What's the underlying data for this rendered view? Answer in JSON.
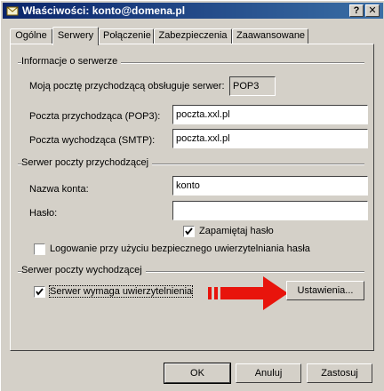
{
  "window": {
    "title": "Właściwości: konto@domena.pl",
    "help_btn": "?",
    "close_btn": "✕"
  },
  "tabs": [
    {
      "label": "Ogólne"
    },
    {
      "label": "Serwery"
    },
    {
      "label": "Połączenie"
    },
    {
      "label": "Zabezpieczenia"
    },
    {
      "label": "Zaawansowane"
    }
  ],
  "server_info": {
    "group_title": "Informacje o serwerze",
    "incoming_type_label": "Moją pocztę przychodzącą obsługuje serwer:",
    "incoming_type_value": "POP3",
    "pop3_label": "Poczta przychodząca (POP3):",
    "pop3_value": "poczta.xxl.pl",
    "smtp_label": "Poczta wychodząca (SMTP):",
    "smtp_value": "poczta.xxl.pl"
  },
  "incoming": {
    "group_title": "Serwer poczty przychodzącej",
    "account_label": "Nazwa konta:",
    "account_value": "konto",
    "password_label": "Hasło:",
    "password_value": "",
    "remember_label": "Zapamiętaj hasło",
    "remember_checked": true,
    "spa_label": "Logowanie przy użyciu bezpiecznego uwierzytelniania hasła",
    "spa_checked": false
  },
  "outgoing": {
    "group_title": "Serwer poczty wychodzącej",
    "auth_label": "Serwer wymaga uwierzytelnienia",
    "auth_checked": true,
    "settings_btn": "Ustawienia...",
    "arrow_color": "#e8140c"
  },
  "footer": {
    "ok": "OK",
    "cancel": "Anuluj",
    "apply": "Zastosuj"
  }
}
